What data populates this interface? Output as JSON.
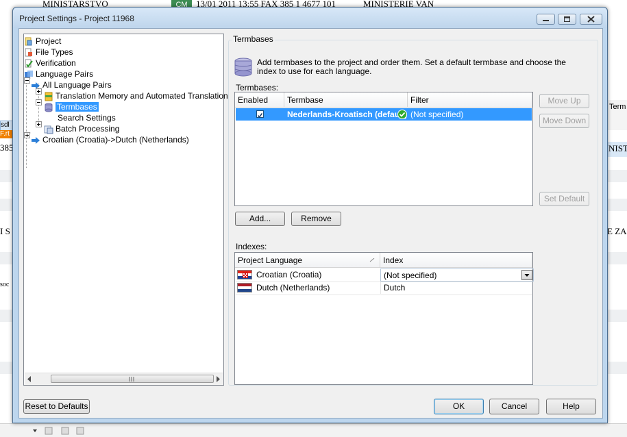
{
  "background": {
    "top_left": "MINISTARSTVO",
    "top_badge": "CM",
    "top_mid": "13/01 2011 13:55 FAX 385 1 4677 101",
    "top_right": "MINISTERIE VAN",
    "left_tab": "sdl",
    "left_orange": "F.rt",
    "left_num": "385",
    "left_s": "I S",
    "left_soc": "soc",
    "right_tab": "Term",
    "right_nist": "NIST",
    "right_za": "E ZA"
  },
  "dialog": {
    "title": "Project Settings - Project 11968"
  },
  "tree": {
    "project": "Project",
    "file_types": "File Types",
    "verification": "Verification",
    "language_pairs": "Language Pairs",
    "all_language_pairs": "All Language Pairs",
    "tm": "Translation Memory and Automated Translation",
    "termbases": "Termbases",
    "search_settings": "Search Settings",
    "batch_processing": "Batch Processing",
    "croatian_dutch": "Croatian (Croatia)->Dutch (Netherlands)"
  },
  "panel": {
    "group_title": "Termbases",
    "description": "Add termbases to the project and order them. Set a default termbase and choose the index to use for each language.",
    "termbases_caption": "Termbases:",
    "columns": {
      "enabled": "Enabled",
      "termbase": "Termbase",
      "filter": "Filter"
    },
    "row": {
      "termbase": "Nederlands-Kroatisch (default)",
      "filter": "(Not specified)"
    },
    "move_up": "Move Up",
    "move_down": "Move Down",
    "set_default": "Set Default",
    "add": "Add...",
    "remove": "Remove",
    "indexes_caption": "Indexes:",
    "idx_columns": {
      "language": "Project Language",
      "index": "Index"
    },
    "idx_rows": [
      {
        "language": "Croatian (Croatia)",
        "index": "(Not specified)"
      },
      {
        "language": "Dutch (Netherlands)",
        "index": "Dutch"
      }
    ]
  },
  "footer": {
    "reset": "Reset to Defaults",
    "ok": "OK",
    "cancel": "Cancel",
    "help": "Help"
  },
  "colors": {
    "selection": "#3399ff",
    "title_bar": "#bed5ec",
    "badge_green": "#3c8c52"
  }
}
